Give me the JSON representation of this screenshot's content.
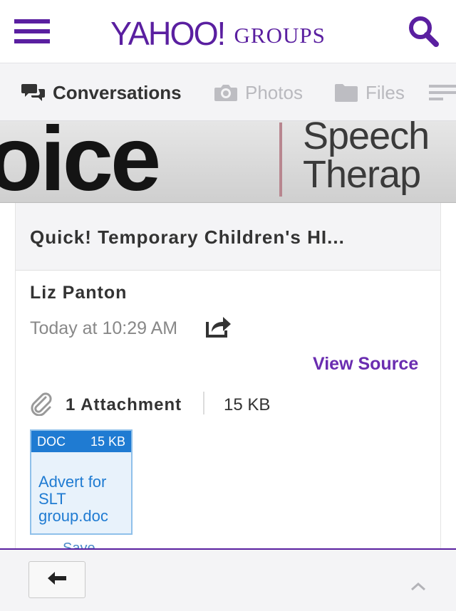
{
  "header": {
    "logo_main": "YAHOO!",
    "logo_sub": "GROUPS",
    "brand_color": "#5a1fa0",
    "menu_icon": "hamburger-menu-icon",
    "search_icon": "search-icon"
  },
  "tabs": [
    {
      "label": "Conversations",
      "icon": "conversations-icon",
      "active": true
    },
    {
      "label": "Photos",
      "icon": "camera-icon",
      "active": false
    },
    {
      "label": "Files",
      "icon": "folder-icon",
      "active": false
    }
  ],
  "banner": {
    "big_text": "oice",
    "line1": "Speech",
    "line2": "Therap"
  },
  "message": {
    "subject": "Quick! Temporary Children's HI...",
    "author": "Liz Panton",
    "timestamp": "Today at 10:29 AM",
    "view_source_label": "View Source",
    "attachments": {
      "count_label": "1 Attachment",
      "total_size": "15 KB",
      "files": [
        {
          "type": "DOC",
          "size": "15 KB",
          "name": "Advert for SLT group.doc",
          "save_label": "Save"
        }
      ]
    }
  },
  "footer": {
    "back_icon": "back-arrow-icon",
    "up_icon": "chevron-up-icon"
  },
  "colors": {
    "accent": "#5a1fa0",
    "link": "#6a2db0",
    "file_blue": "#1f7bd2",
    "muted": "#888888"
  }
}
